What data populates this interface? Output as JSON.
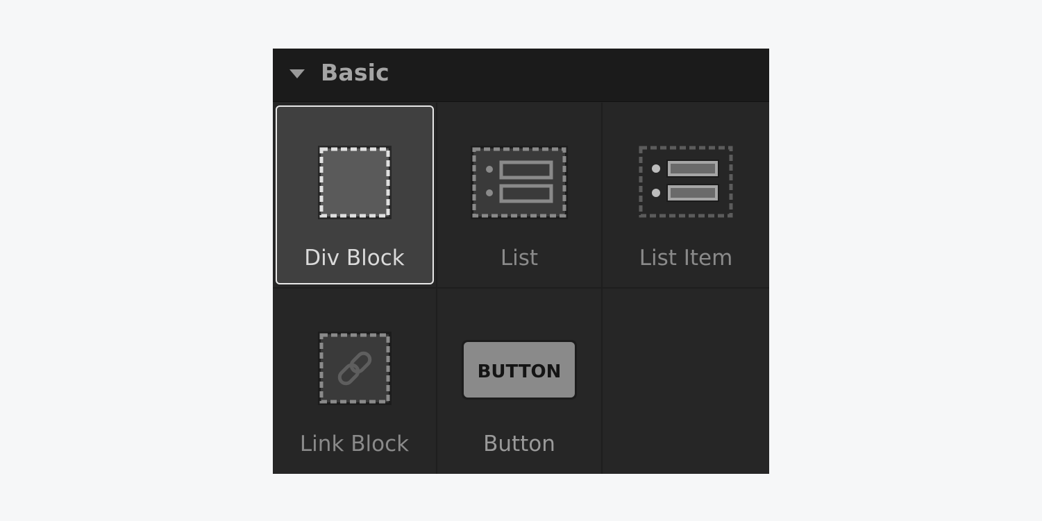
{
  "panel": {
    "section_title": "Basic",
    "caret_icon": "caret-down-icon"
  },
  "elements": [
    {
      "label": "Div Block",
      "icon": "div-block-icon",
      "selected": true
    },
    {
      "label": "List",
      "icon": "list-icon",
      "selected": false
    },
    {
      "label": "List Item",
      "icon": "list-item-icon",
      "selected": false
    },
    {
      "label": "Link Block",
      "icon": "link-block-icon",
      "selected": false
    },
    {
      "label": "Button",
      "icon": "button-icon",
      "selected": false,
      "icon_text": "BUTTON"
    }
  ],
  "colors": {
    "page_bg": "#f6f7f8",
    "panel_bg": "#262626",
    "header_bg": "#1b1b1b",
    "selected_bg": "#404040",
    "selected_border": "#e8e8e8"
  }
}
